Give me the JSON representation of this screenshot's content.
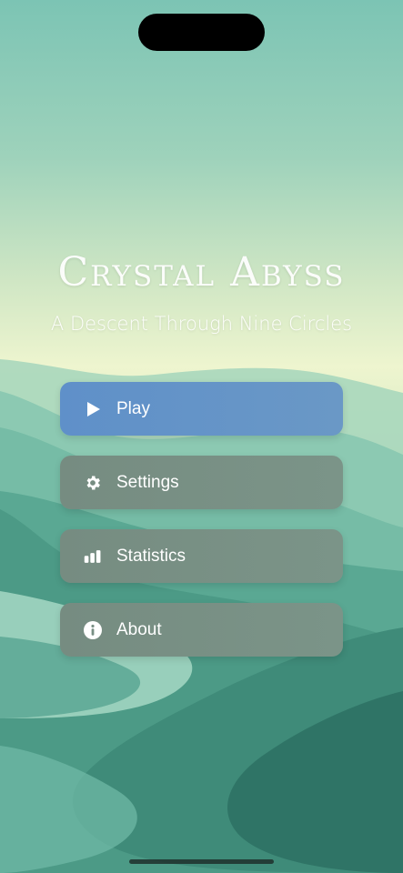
{
  "app": {
    "title": "Crystal Abyss",
    "subtitle": "A Descent Through Nine Circles"
  },
  "menu": {
    "items": [
      {
        "label": "Play",
        "icon": "play-icon",
        "style": "primary"
      },
      {
        "label": "Settings",
        "icon": "gear-icon",
        "style": "secondary"
      },
      {
        "label": "Statistics",
        "icon": "bar-chart-icon",
        "style": "secondary"
      },
      {
        "label": "About",
        "icon": "info-icon",
        "style": "secondary"
      }
    ]
  },
  "colors": {
    "primary_button": "#6393c8",
    "secondary_button": "#788f84",
    "text": "#ffffff"
  }
}
